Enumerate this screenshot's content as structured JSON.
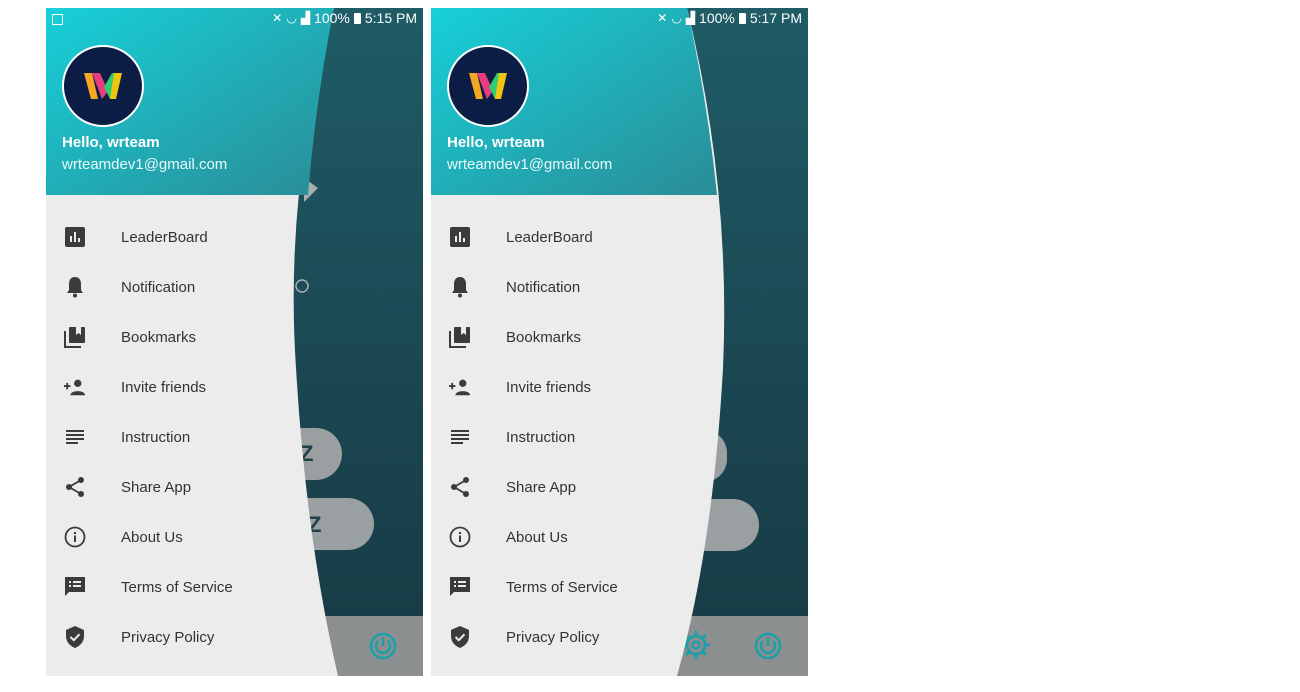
{
  "screens": [
    {
      "status": {
        "percent": "100%",
        "time": "5:15 PM"
      },
      "header": {
        "greeting": "Hello, wrteam",
        "email": "wrteamdev1@gmail.com"
      },
      "background_fragments": [
        "Z",
        "Z"
      ]
    },
    {
      "status": {
        "percent": "100%",
        "time": "5:17 PM"
      },
      "header": {
        "greeting": "Hello, wrteam",
        "email": "wrteamdev1@gmail.com"
      }
    }
  ],
  "menu": [
    {
      "label": "LeaderBoard",
      "icon": "leaderboard-icon"
    },
    {
      "label": "Notification",
      "icon": "bell-icon"
    },
    {
      "label": "Bookmarks",
      "icon": "bookmarks-icon"
    },
    {
      "label": "Invite friends",
      "icon": "person-add-icon"
    },
    {
      "label": "Instruction",
      "icon": "lines-icon"
    },
    {
      "label": "Share App",
      "icon": "share-icon"
    },
    {
      "label": "About Us",
      "icon": "info-icon"
    },
    {
      "label": "Terms of Service",
      "icon": "chat-list-icon"
    },
    {
      "label": "Privacy Policy",
      "icon": "shield-check-icon"
    }
  ],
  "colors": {
    "header_gradient_start": "#1ccbd4",
    "header_gradient_end": "#2a8f98",
    "drawer_bg": "#ececec",
    "icon": "#3b3b3b",
    "app_bg": "#1d4f58",
    "power_icon": "#1aa0a8"
  }
}
